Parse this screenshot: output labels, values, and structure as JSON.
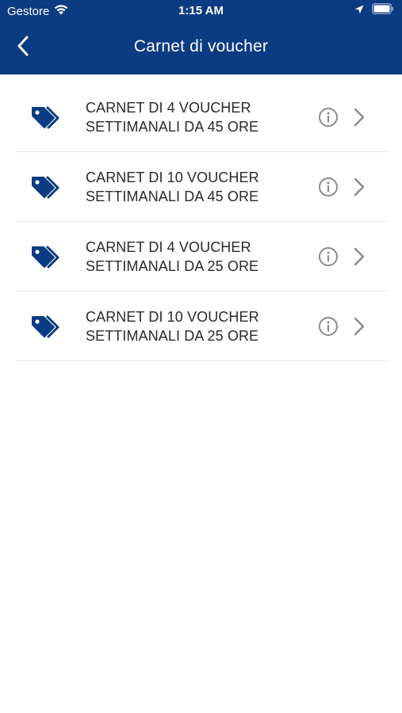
{
  "status_bar": {
    "carrier": "Gestore",
    "time": "1:15 AM"
  },
  "nav": {
    "title": "Carnet di voucher",
    "back_icon": "chevron-left-icon"
  },
  "items": [
    {
      "line1": "CARNET DI 4 VOUCHER",
      "line2": "SETTIMANALI DA 45 ORE"
    },
    {
      "line1": "CARNET DI 10 VOUCHER",
      "line2": "SETTIMANALI DA 45 ORE"
    },
    {
      "line1": "CARNET DI 4 VOUCHER",
      "line2": "SETTIMANALI DA 25 ORE"
    },
    {
      "line1": "CARNET DI 10 VOUCHER",
      "line2": "SETTIMANALI DA 25 ORE"
    }
  ],
  "icons": {
    "row_leading": "tags-icon",
    "row_info": "info-circle-icon",
    "row_trailing": "chevron-right-icon"
  },
  "colors": {
    "header_bg": "#0b3b82",
    "tag_icon": "#0b3b82",
    "secondary_icon": "#8a8a8a",
    "divider": "#e6e6e6"
  }
}
